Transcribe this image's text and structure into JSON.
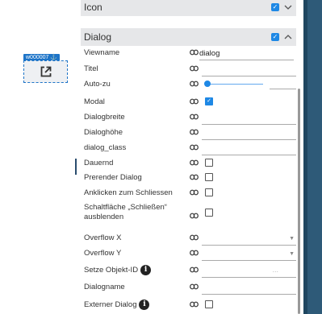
{
  "widget": {
    "tag": "w000007 ⚓"
  },
  "sections": {
    "icon": "Icon",
    "dialog": "Dialog"
  },
  "props": {
    "viewname": {
      "label": "Viewname",
      "value": "dialog"
    },
    "titel": {
      "label": "Titel"
    },
    "autozu": {
      "label": "Auto-zu"
    },
    "modal": {
      "label": "Modal",
      "checked": true
    },
    "dialogbreite": {
      "label": "Dialogbreite"
    },
    "dialoghoehe": {
      "label": "Dialoghöhe"
    },
    "dialog_class": {
      "label": "dialog_class"
    },
    "dauernd": {
      "label": "Dauernd",
      "checked": false
    },
    "prerender": {
      "label": "Prerender Dialog",
      "checked": false
    },
    "anklicken": {
      "label": "Anklicken zum Schliessen",
      "checked": false
    },
    "schaltflaeche": {
      "label": "Schaltfläche „Schließen“ ausblenden",
      "checked": false
    },
    "overflowx": {
      "label": "Overflow X"
    },
    "overflowy": {
      "label": "Overflow Y"
    },
    "objektid": {
      "label": "Setze Objekt-ID",
      "placeholder": "..."
    },
    "dialogname": {
      "label": "Dialogname"
    },
    "extern": {
      "label": "Externer Dialog",
      "checked": false
    }
  },
  "colors": {
    "accent": "#1e88e5",
    "header_bg": "#e6e7e9",
    "strip": "#2e5a78"
  },
  "icons": {
    "link": "link-icon",
    "info": "info-icon",
    "open": "open-external-icon"
  }
}
